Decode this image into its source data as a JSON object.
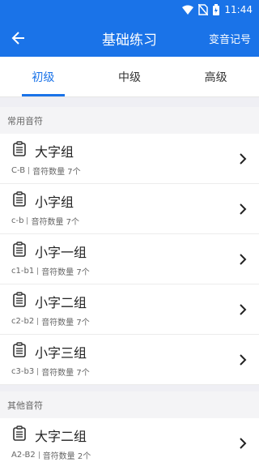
{
  "status": {
    "time": "11:44"
  },
  "header": {
    "title": "基础练习",
    "right_action": "变音记号"
  },
  "tabs": [
    {
      "label": "初级"
    },
    {
      "label": "中级"
    },
    {
      "label": "高级"
    }
  ],
  "sections": [
    {
      "title": "常用音符",
      "items": [
        {
          "title": "大字组",
          "range": "C-B",
          "count": "音符数量 7个"
        },
        {
          "title": "小字组",
          "range": "c-b",
          "count": "音符数量 7个"
        },
        {
          "title": "小字一组",
          "range": "c1-b1",
          "count": "音符数量 7个"
        },
        {
          "title": "小字二组",
          "range": "c2-b2",
          "count": "音符数量 7个"
        },
        {
          "title": "小字三组",
          "range": "c3-b3",
          "count": "音符数量 7个"
        }
      ]
    },
    {
      "title": "其他音符",
      "items": [
        {
          "title": "大字二组",
          "range": "A2-B2",
          "count": "音符数量 2个"
        }
      ]
    }
  ]
}
